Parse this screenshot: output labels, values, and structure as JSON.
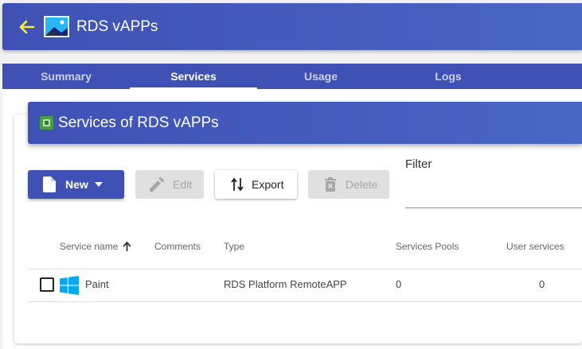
{
  "header": {
    "title": "RDS vAPPs",
    "back_icon": "arrow-left-icon",
    "app_icon": "picture-icon",
    "accent_color": "#3f51b5",
    "back_icon_color": "#ffeb3b"
  },
  "tabs": [
    {
      "label": "Summary",
      "active": false
    },
    {
      "label": "Services",
      "active": true
    },
    {
      "label": "Usage",
      "active": false
    },
    {
      "label": "Logs",
      "active": false
    }
  ],
  "card": {
    "title": "Services of RDS vAPPs",
    "icon": "chip-icon"
  },
  "toolbar": {
    "new_label": "New",
    "edit_label": "Edit",
    "export_label": "Export",
    "delete_label": "Delete"
  },
  "filter": {
    "label": "Filter",
    "value": ""
  },
  "table": {
    "columns": [
      "Service name",
      "Comments",
      "Type",
      "Services Pools",
      "User services"
    ],
    "sort_column": "Service name",
    "sort_direction": "ascending",
    "rows": [
      {
        "name": "Paint",
        "comments": "",
        "type": "RDS Platform RemoteAPP",
        "services_pools": "0",
        "user_services": "0",
        "icon": "windows-logo-icon",
        "selected": false
      }
    ]
  }
}
